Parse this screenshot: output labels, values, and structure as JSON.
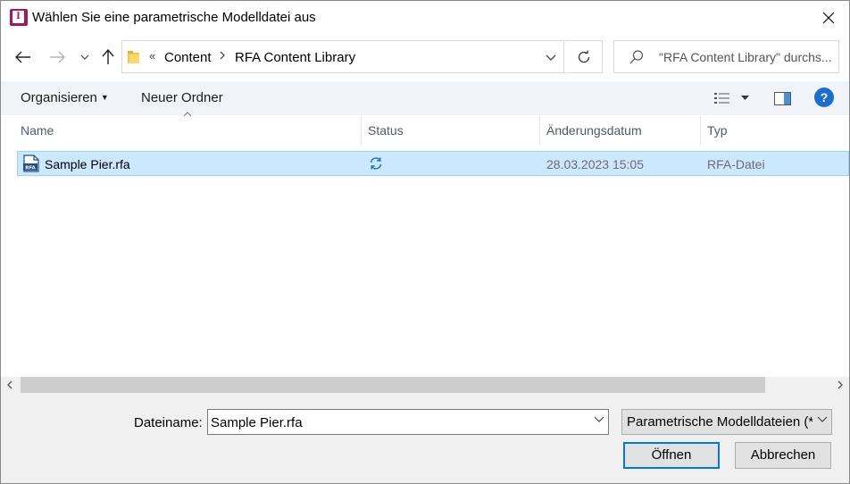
{
  "window": {
    "title": "Wählen Sie eine parametrische Modelldatei aus",
    "app_icon_letter": "I"
  },
  "address": {
    "overflow": "«",
    "breadcrumbs": [
      "Content",
      "RFA Content Library"
    ]
  },
  "search": {
    "placeholder": "\"RFA Content Library\" durchs..."
  },
  "toolbar": {
    "organize_label": "Organisieren",
    "new_folder_label": "Neuer Ordner",
    "help_label": "?"
  },
  "columns": {
    "name": "Name",
    "status": "Status",
    "date": "Änderungsdatum",
    "type": "Typ"
  },
  "files": [
    {
      "name": "Sample Pier.rfa",
      "icon_label": "RFA",
      "status_icon": "sync-icon",
      "date": "28.03.2023 15:05",
      "type": "RFA-Datei",
      "selected": true
    }
  ],
  "footer": {
    "filename_label": "Dateiname:",
    "filename_value": "Sample Pier.rfa",
    "filetype_value": "Parametrische Modelldateien (*",
    "open_label": "Öffnen",
    "cancel_label": "Abbrechen"
  },
  "colors": {
    "accent": "#0078d7",
    "selection": "#cce8ff",
    "toolbar_bg": "#f0f4f9",
    "app_icon": "#a8145e",
    "help_icon": "#1a6fce"
  }
}
